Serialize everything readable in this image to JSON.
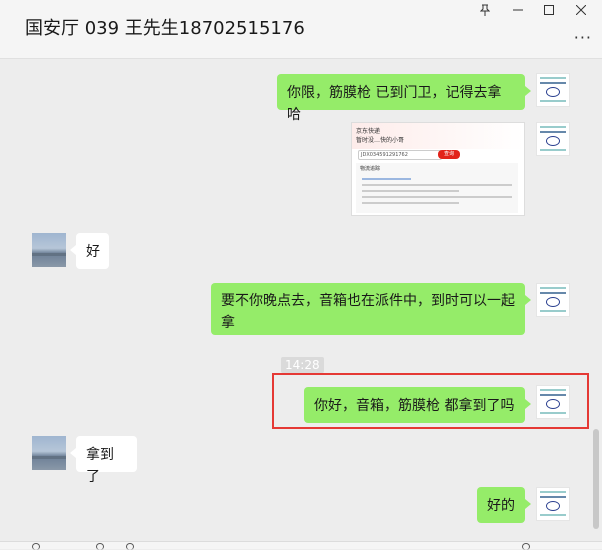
{
  "header": {
    "title": "国安厅 039 王先生18702515176",
    "pin_icon": "pin-icon",
    "minimize_icon": "minimize-icon",
    "maximize_icon": "maximize-icon",
    "close_icon": "close-icon",
    "more_icon": "more-icon"
  },
  "messages": [
    {
      "side": "out",
      "type": "text",
      "text": "你限，筋膜枪 已到门卫，记得去拿哈"
    },
    {
      "side": "out",
      "type": "image",
      "image": {
        "title": "京东快递",
        "subtitle": "暂时没…快的小哥",
        "tracking": "JDX034591291762",
        "button": "查询",
        "section": "物流追踪"
      }
    },
    {
      "side": "in",
      "type": "text",
      "text": "好"
    },
    {
      "side": "out",
      "type": "text",
      "text": "要不你晚点去，音箱也在派件中，到时可以一起拿"
    },
    {
      "side": "out",
      "type": "text",
      "text": "你好，音箱，筋膜枪 都拿到了吗"
    },
    {
      "side": "in",
      "type": "text",
      "text": "拿到了"
    },
    {
      "side": "out",
      "type": "text",
      "text": "好的"
    }
  ],
  "timestamp": "14:28"
}
